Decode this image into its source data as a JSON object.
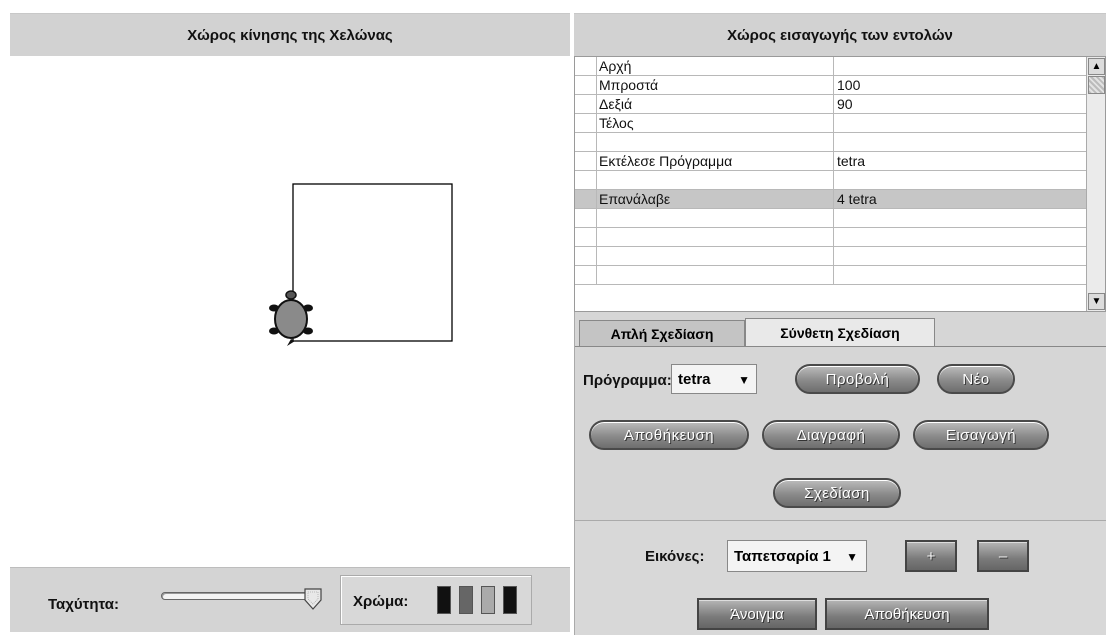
{
  "left_panel": {
    "title": "Χώρος κίνησης της Χελώνας",
    "speed_label": "Ταχύτητα:",
    "speed_level": 0.95,
    "color_label": "Χρώμα:",
    "swatches": [
      "#111111",
      "#666666",
      "#aaaaaa",
      "#111111"
    ]
  },
  "right_panel": {
    "title": "Χώρος εισαγωγής των εντολών",
    "rows": [
      {
        "cmd": "Αρχή",
        "arg": ""
      },
      {
        "cmd": "Μπροστά",
        "arg": "100"
      },
      {
        "cmd": "Δεξιά",
        "arg": "90"
      },
      {
        "cmd": "Τέλος",
        "arg": ""
      },
      {
        "cmd": "",
        "arg": ""
      },
      {
        "cmd": "Εκτέλεσε Πρόγραμμα",
        "arg": "tetra"
      },
      {
        "cmd": "",
        "arg": ""
      },
      {
        "cmd": "Επανάλαβε",
        "arg": "4 tetra"
      },
      {
        "cmd": "",
        "arg": ""
      },
      {
        "cmd": "",
        "arg": ""
      },
      {
        "cmd": "",
        "arg": ""
      },
      {
        "cmd": "",
        "arg": ""
      }
    ],
    "selected_row": 7,
    "tabs": {
      "simple": "Απλή Σχεδίαση",
      "complex": "Σύνθετη Σχεδίαση"
    },
    "program_label": "Πρόγραμμα:",
    "program_value": "tetra",
    "buttons": {
      "preview": "Προβολή",
      "new": "Νέο",
      "save": "Αποθήκευση",
      "delete": "Διαγραφή",
      "import": "Εισαγωγή",
      "draw": "Σχεδίαση"
    },
    "images_label": "Εικόνες:",
    "images_value": "Ταπετσαρία 1",
    "plus": "+",
    "minus": "–",
    "open": "Άνοιγμα",
    "save_image": "Αποθήκευση"
  }
}
